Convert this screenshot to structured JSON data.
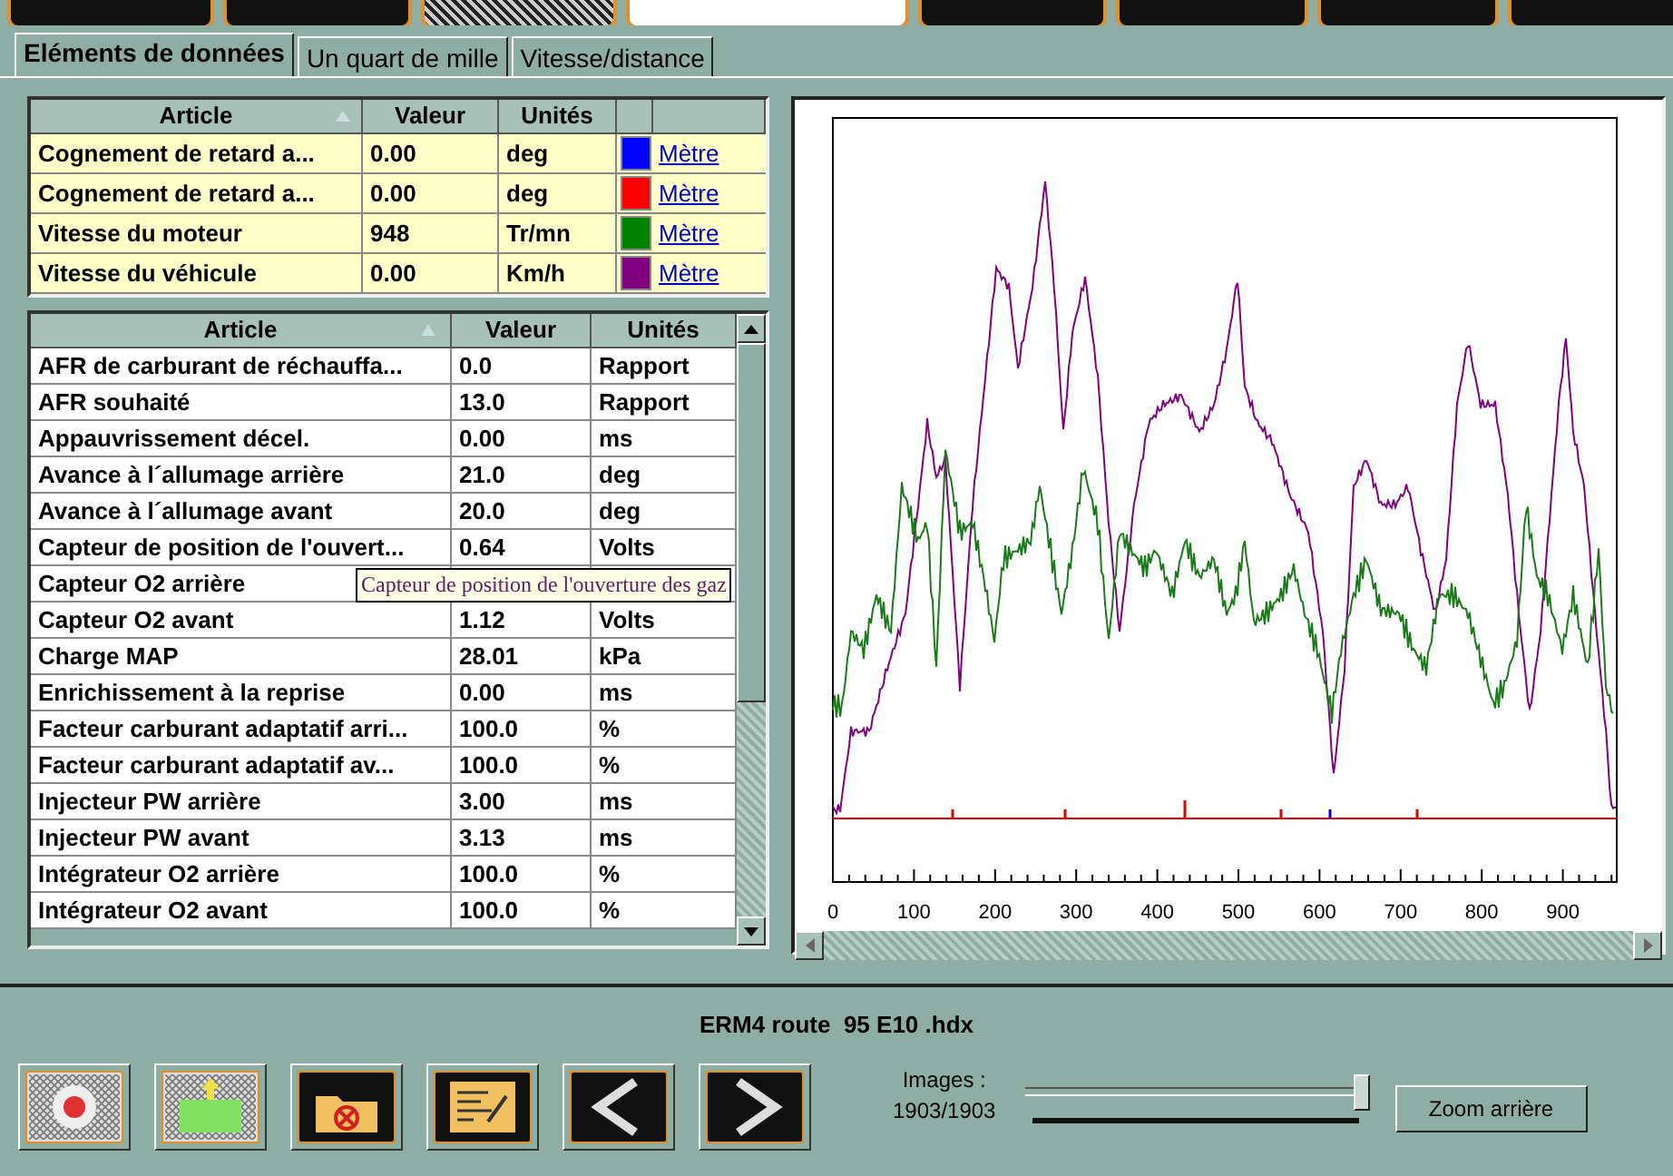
{
  "top_toolbar": [
    {
      "kind": "button"
    },
    {
      "kind": "button"
    },
    {
      "kind": "mesh"
    },
    {
      "kind": "logo"
    },
    {
      "kind": "button"
    },
    {
      "kind": "button"
    },
    {
      "kind": "button"
    },
    {
      "kind": "button"
    }
  ],
  "tabs": [
    {
      "label": "Eléments de données",
      "selected": true
    },
    {
      "label": "Un quart de mille",
      "selected": false
    },
    {
      "label": "Vitesse/distance",
      "selected": false
    }
  ],
  "legend_table": {
    "columns": [
      "Article",
      "Valeur",
      "Unités"
    ],
    "rows": [
      {
        "article": "Cognement de retard a...",
        "value": "0.00",
        "unit": "deg",
        "color": "#0000ff",
        "link": "Mètre"
      },
      {
        "article": "Cognement de retard a...",
        "value": "0.00",
        "unit": "deg",
        "color": "#ff0000",
        "link": "Mètre"
      },
      {
        "article": "Vitesse du moteur",
        "value": "948",
        "unit": "Tr/mn",
        "color": "#008000",
        "link": "Mètre"
      },
      {
        "article": "Vitesse du véhicule",
        "value": "0.00",
        "unit": "Km/h",
        "color": "#800080",
        "link": "Mètre"
      }
    ]
  },
  "data_table": {
    "columns": [
      "Article",
      "Valeur",
      "Unités"
    ],
    "rows": [
      {
        "article": "AFR de carburant de réchauffa...",
        "value": "0.0",
        "unit": "Rapport"
      },
      {
        "article": "AFR souhaité",
        "value": "13.0",
        "unit": "Rapport"
      },
      {
        "article": "Appauvrissement décel.",
        "value": "0.00",
        "unit": "ms"
      },
      {
        "article": "Avance à l´allumage arrière",
        "value": "21.0",
        "unit": "deg"
      },
      {
        "article": "Avance à l´allumage avant",
        "value": "20.0",
        "unit": "deg"
      },
      {
        "article": "Capteur de position de l'ouvert...",
        "value": "0.64",
        "unit": "Volts"
      },
      {
        "article": "Capteur O2 arrière"
      },
      {
        "article": "Capteur O2 avant",
        "value": "1.12",
        "unit": "Volts"
      },
      {
        "article": "Charge MAP",
        "value": "28.01",
        "unit": "kPa"
      },
      {
        "article": "Enrichissement à la reprise",
        "value": "0.00",
        "unit": "ms"
      },
      {
        "article": "Facteur carburant adaptatif arri...",
        "value": "100.0",
        "unit": "%"
      },
      {
        "article": "Facteur carburant adaptatif av...",
        "value": "100.0",
        "unit": "%"
      },
      {
        "article": "Injecteur PW arrière",
        "value": "3.00",
        "unit": "ms"
      },
      {
        "article": "Injecteur PW avant",
        "value": "3.13",
        "unit": "ms"
      },
      {
        "article": "Intégrateur O2 arrière",
        "value": "100.0",
        "unit": "%"
      },
      {
        "article": "Intégrateur O2 avant",
        "value": "100.0",
        "unit": "%"
      }
    ]
  },
  "tooltip": "Capteur de position de l'ouverture des gaz",
  "chart": {
    "x_tick_labels": [
      "0",
      "100",
      "200",
      "300",
      "400",
      "500",
      "600",
      "700",
      "800",
      "900"
    ]
  },
  "file_title": "ERM4 route  95 E10 .hdx",
  "buttons": [
    {
      "kind": "record"
    },
    {
      "kind": "import"
    },
    {
      "kind": "delete"
    },
    {
      "kind": "notes"
    },
    {
      "kind": "previous"
    },
    {
      "kind": "next"
    }
  ],
  "images": {
    "label": "Images :",
    "count": "1903/1903",
    "level": 1
  },
  "zoom_button": "Zoom arrière"
}
